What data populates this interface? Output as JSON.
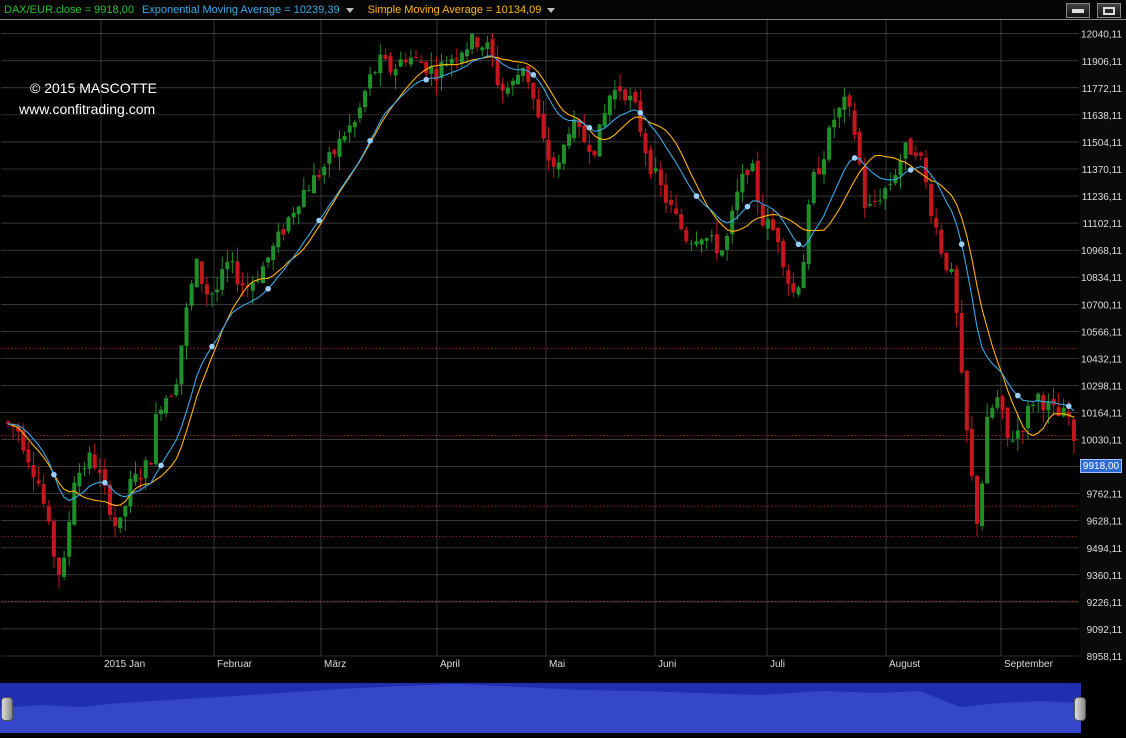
{
  "legend": {
    "main": "DAX/EUR.close = 9918,00",
    "ema": "Exponential Moving Average = 10239,39",
    "sma": "Simple Moving Average = 10134,09"
  },
  "watermark": {
    "copyright": "© 2015 MASCOTTE",
    "website": "www.confitrading.com"
  },
  "current_price_label": "9918,00",
  "colors": {
    "background": "#000000",
    "grid": "#5a5a5a",
    "up_candle": "#1f8f2a",
    "down_candle": "#c4161c",
    "ema": "#37a8e6",
    "sma": "#ffb400",
    "support_lines": "#b02020",
    "navigator": "#1f2fb0",
    "price_badge": "#2e6bd6"
  },
  "chart_data": {
    "type": "candlestick",
    "instrument": "DAX/EUR",
    "ylim": [
      8958.11,
      12108
    ],
    "yticks": [
      12040.11,
      11906.11,
      11772.11,
      11638.11,
      11504.11,
      11370.11,
      11236.11,
      11102.11,
      10968.11,
      10834.11,
      10700.11,
      10566.11,
      10432.11,
      10298.11,
      10164.11,
      10030.11,
      9896.11,
      9762.11,
      9628.11,
      9494.11,
      9360.11,
      9226.11,
      9092.11,
      8958.11
    ],
    "ytick_labels": [
      "12040,11",
      "11906,11",
      "11772,11",
      "11638,11",
      "11504,11",
      "11370,11",
      "11236,11",
      "11102,11",
      "10968,11",
      "10834,11",
      "10700,11",
      "10566,11",
      "10432,11",
      "10298,11",
      "10164,11",
      "10030,11",
      "9896,11",
      "9762,11",
      "9628,11",
      "9494,11",
      "9360,11",
      "9226,11",
      "9092,11",
      "8958,11"
    ],
    "x_labels": [
      "2015 Jan",
      "Februar",
      "März",
      "April",
      "Mai",
      "Juni",
      "Juli",
      "August",
      "September"
    ],
    "grid": true,
    "support_lines": [
      10480,
      10050,
      9700,
      9550,
      9230
    ],
    "close_path": [
      {
        "label": "2015 Jan",
        "close": 9760
      },
      {
        "label": "Februar",
        "close": 10730
      },
      {
        "label": "März",
        "close": 11400
      },
      {
        "label": "April",
        "close": 11980
      },
      {
        "label": "Mai",
        "close": 11450
      },
      {
        "label": "Juni",
        "close": 11300
      },
      {
        "label": "Juli",
        "close": 10950
      },
      {
        "label": "August",
        "close": 11480
      },
      {
        "label": "September",
        "close": 10100
      }
    ],
    "series": [
      {
        "name": "DAX/EUR.close",
        "last": 9918.0
      },
      {
        "name": "Exponential Moving Average",
        "last": 10239.39
      },
      {
        "name": "Simple Moving Average",
        "last": 10134.09
      }
    ]
  }
}
